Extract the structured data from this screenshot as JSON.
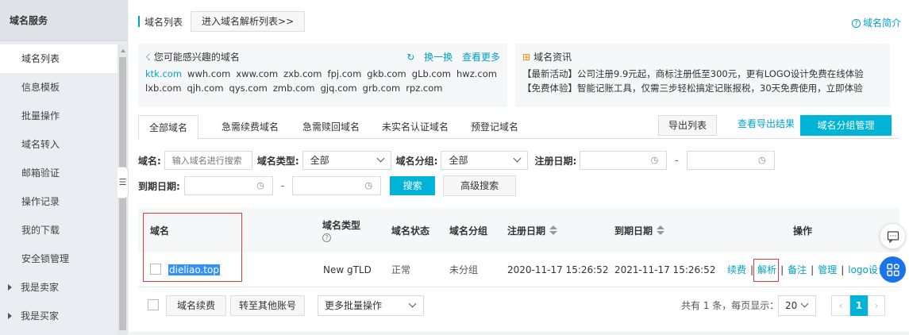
{
  "sidebar": {
    "title": "域名服务",
    "items": [
      {
        "label": "域名列表",
        "active": true
      },
      {
        "label": "信息模板"
      },
      {
        "label": "批量操作"
      },
      {
        "label": "域名转入"
      },
      {
        "label": "邮箱验证"
      },
      {
        "label": "操作记录"
      },
      {
        "label": "我的下载"
      },
      {
        "label": "安全锁管理"
      }
    ],
    "groups": [
      {
        "label": "我是卖家"
      },
      {
        "label": "我是买家"
      }
    ]
  },
  "header": {
    "title": "域名列表",
    "dns_button": "进入域名解析列表>>",
    "intro_link": "域名简介",
    "intro_icon": "?"
  },
  "recommend": {
    "title": "您可能感兴趣的域名",
    "refresh": "换一换",
    "more": "查看更多",
    "row1": [
      "ktk.com",
      "wwh.com",
      "xww.com",
      "zxb.com",
      "fpj.com",
      "gkb.com",
      "gLb.com",
      "hwz.com"
    ],
    "row2": [
      "lxb.com",
      "qjh.com",
      "qys.com",
      "zmb.com",
      "gjq.com",
      "grb.com",
      "rpz.com"
    ]
  },
  "news": {
    "title": "域名资讯",
    "line1": "【最新活动】公司注册9.9元起，商标注册低至300元，更有LOGO设计免费在线体验",
    "line2": "【免费体验】智能记账工具，仅需三步轻松搞定记账报税，30天免费使用，立即体验"
  },
  "tabs": [
    "全部域名",
    "急需续费域名",
    "急需赎回域名",
    "未实名认证域名",
    "预登记域名"
  ],
  "actions": {
    "export": "导出列表",
    "export_result": "查看导出结果",
    "group_manage": "域名分组管理"
  },
  "filters": {
    "domain_label": "域名:",
    "domain_placeholder": "输入域名进行搜索",
    "type_label": "域名类型:",
    "type_value": "全部",
    "group_label": "域名分组:",
    "group_value": "全部",
    "reg_label": "注册日期:",
    "exp_label": "到期日期:",
    "dash": "-",
    "search": "搜索",
    "advanced": "高级搜索"
  },
  "table": {
    "headers": {
      "domain": "域名",
      "type": "域名类型",
      "status": "域名状态",
      "group": "域名分组",
      "reg": "注册日期",
      "exp": "到期日期",
      "ops": "操作"
    },
    "help_icon": "?",
    "rows": [
      {
        "domain": "dieliao.top",
        "type": "New gTLD",
        "status": "正常",
        "group": "未分组",
        "reg": "2020-11-17 15:26:52",
        "exp": "2021-11-17 15:26:52",
        "ops": {
          "renew": "续费",
          "resolve": "解析",
          "record": "备注",
          "manage": "管理",
          "logo": "logo设计"
        }
      }
    ]
  },
  "footer": {
    "renew": "域名续费",
    "transfer": "转至其他账号",
    "batch": "更多批量操作",
    "total": "共有 1 条，每页显示：",
    "page_size": "20",
    "page": "1",
    "prev": "‹",
    "next": "›"
  },
  "colors": {
    "accent": "#00b4d8",
    "link": "#00a2ca",
    "highlight": "#e53935"
  }
}
